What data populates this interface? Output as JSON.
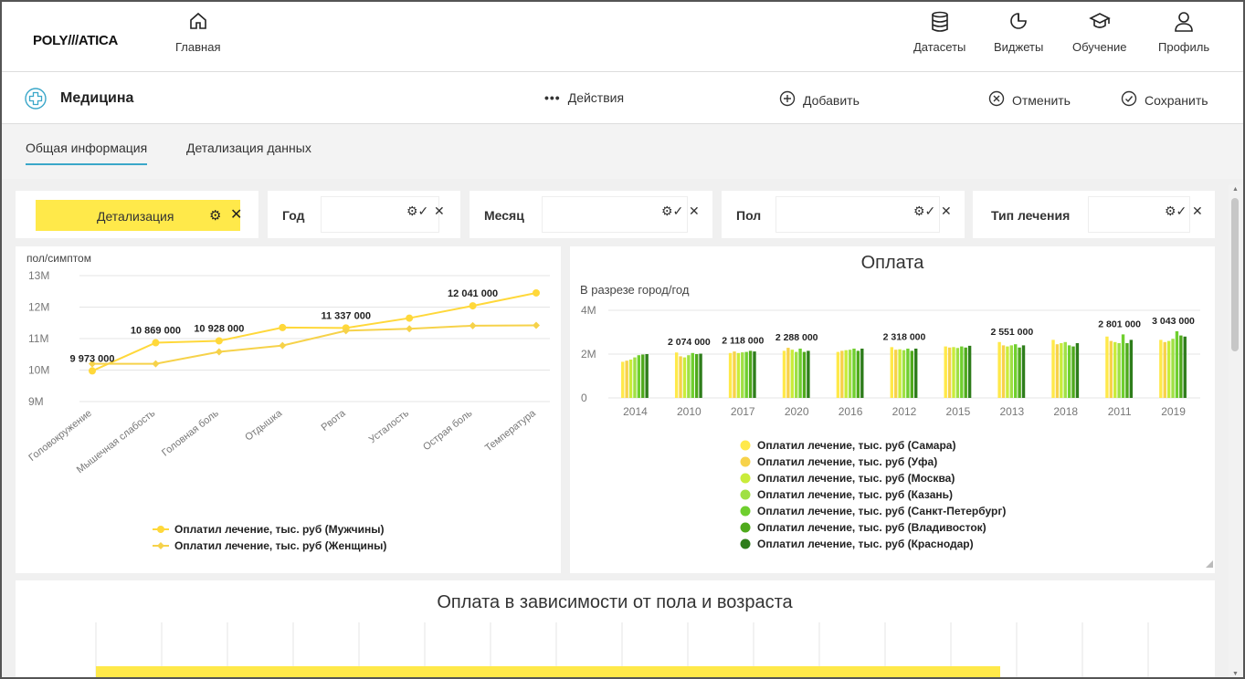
{
  "app": {
    "logo": "POLY///ATICA",
    "nav": {
      "home": "Главная",
      "datasets": "Датасеты",
      "widgets": "Виджеты",
      "learning": "Обучение",
      "profile": "Профиль"
    }
  },
  "dashboard": {
    "title": "Медицина",
    "actions_label": "Действия",
    "add_label": "Добавить",
    "cancel_label": "Отменить",
    "save_label": "Сохранить"
  },
  "tabs": [
    {
      "label": "Общая информация",
      "active": true
    },
    {
      "label": "Детализация данных",
      "active": false
    }
  ],
  "filters": {
    "detalization": "Детализация",
    "items": [
      {
        "label": "Год"
      },
      {
        "label": "Месяц"
      },
      {
        "label": "Пол"
      },
      {
        "label": "Тип лечения"
      }
    ]
  },
  "chart_data": [
    {
      "type": "line",
      "title": "",
      "ylabel": "пол/симптом",
      "ylim": [
        9000000,
        13000000
      ],
      "yticks": [
        "9M",
        "10M",
        "11M",
        "12M",
        "13M"
      ],
      "categories": [
        "Головокружение",
        "Мышечная слабость",
        "Головная боль",
        "Отдышка",
        "Рвота",
        "Усталость",
        "Острая боль",
        "Температура"
      ],
      "series": [
        {
          "name": "Оплатил лечение, тыс. руб (Мужчины)",
          "color": "#ffd83a",
          "values": [
            9973000,
            10869000,
            10928000,
            11350000,
            11337000,
            11650000,
            12041000,
            12450000
          ]
        },
        {
          "name": "Оплатил лечение, тыс. руб (Женщины)",
          "color": "#f6d24a",
          "values": [
            10200000,
            10200000,
            10580000,
            10780000,
            11250000,
            11310000,
            11410000,
            11420000
          ]
        }
      ],
      "data_labels": [
        {
          "index": 0,
          "text": "9 973 000"
        },
        {
          "index": 1,
          "text": "10 869 000"
        },
        {
          "index": 2,
          "text": "10 928 000"
        },
        {
          "index": 4,
          "text": "11 337 000"
        },
        {
          "index": 6,
          "text": "12 041 000"
        }
      ]
    },
    {
      "type": "bar",
      "title": "Оплата",
      "subtitle": "В разрезе город/год",
      "ylim": [
        0,
        4000000
      ],
      "yticks": [
        "0",
        "2M",
        "4M"
      ],
      "categories": [
        "2014",
        "2010",
        "2017",
        "2020",
        "2016",
        "2012",
        "2015",
        "2013",
        "2018",
        "2011",
        "2019"
      ],
      "series": [
        {
          "name": "Оплатил лечение, тыс. руб (Самара)",
          "color": "#ffe94a",
          "values": [
            1650000,
            2074000,
            2050000,
            2150000,
            2100000,
            2318000,
            2350000,
            2551000,
            2650000,
            2801000,
            2650000
          ]
        },
        {
          "name": "Оплатил лечение, тыс. руб (Уфа)",
          "color": "#f7d24a",
          "values": [
            1700000,
            1900000,
            2118000,
            2288000,
            2150000,
            2200000,
            2300000,
            2400000,
            2450000,
            2600000,
            2550000
          ]
        },
        {
          "name": "Оплатил лечение, тыс. руб (Москва)",
          "color": "#c9ec3a",
          "values": [
            1750000,
            1850000,
            2050000,
            2200000,
            2180000,
            2220000,
            2320000,
            2350000,
            2500000,
            2550000,
            2600000
          ]
        },
        {
          "name": "Оплатил лечение, тыс. руб (Казань)",
          "color": "#9fe044",
          "values": [
            1850000,
            1950000,
            2080000,
            2100000,
            2200000,
            2180000,
            2280000,
            2400000,
            2550000,
            2500000,
            2700000
          ]
        },
        {
          "name": "Оплатил лечение, тыс. руб (Санкт-Петербург)",
          "color": "#6fcf2e",
          "values": [
            1950000,
            2050000,
            2100000,
            2250000,
            2250000,
            2250000,
            2350000,
            2450000,
            2400000,
            2900000,
            3043000
          ]
        },
        {
          "name": "Оплатил лечение, тыс. руб (Владивосток)",
          "color": "#4faa1c",
          "values": [
            1980000,
            2000000,
            2150000,
            2100000,
            2150000,
            2150000,
            2300000,
            2300000,
            2350000,
            2500000,
            2850000
          ]
        },
        {
          "name": "Оплатил лечение, тыс. руб (Краснодар)",
          "color": "#2e7d1b",
          "values": [
            2000000,
            2020000,
            2120000,
            2150000,
            2250000,
            2250000,
            2380000,
            2400000,
            2500000,
            2650000,
            2800000
          ]
        }
      ],
      "data_labels": [
        {
          "index": 1,
          "text": "2 074 000"
        },
        {
          "index": 2,
          "text": "2 118 000"
        },
        {
          "index": 3,
          "text": "2 288 000"
        },
        {
          "index": 5,
          "text": "2 318 000"
        },
        {
          "index": 7,
          "text": "2 551 000"
        },
        {
          "index": 9,
          "text": "2 801 000"
        },
        {
          "index": 10,
          "text": "3 043 000"
        }
      ]
    },
    {
      "type": "bar",
      "title": "Оплата в зависимости от пола и возраста",
      "series": [
        {
          "name": "",
          "color": "#ffe94a"
        }
      ]
    }
  ]
}
